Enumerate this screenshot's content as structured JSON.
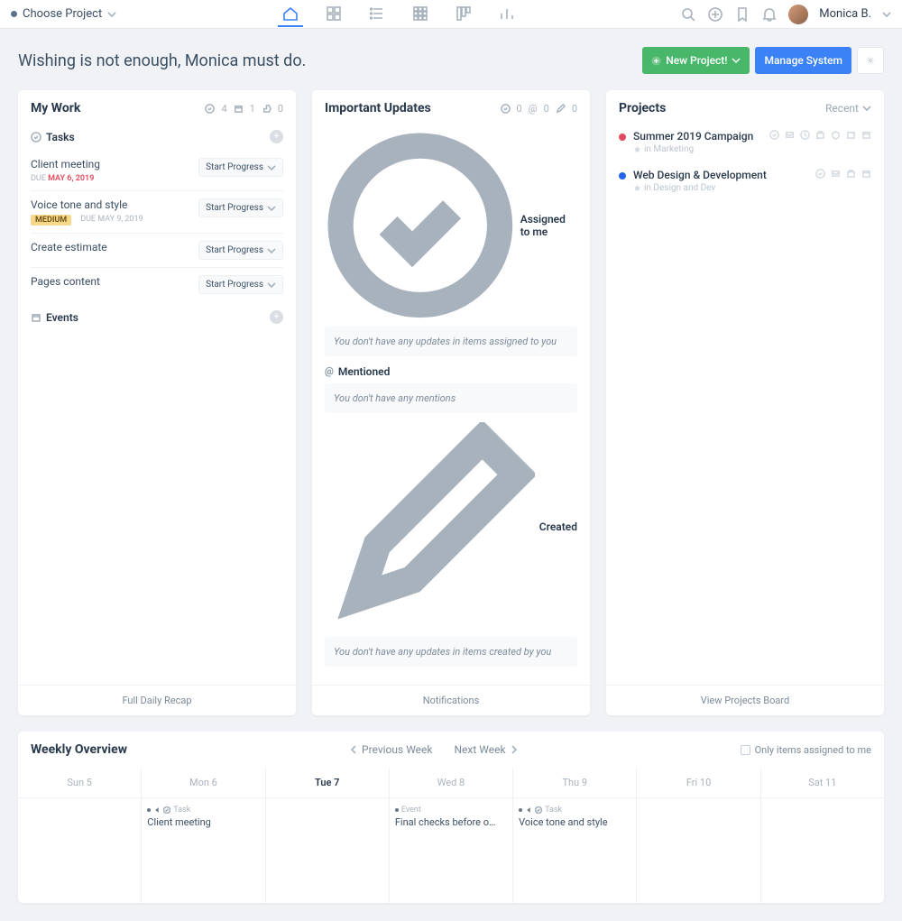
{
  "topbar": {
    "project_chooser": "Choose Project",
    "username": "Monica B."
  },
  "header": {
    "greeting": "Wishing is not enough, Monica must do.",
    "new_project": "New Project!",
    "manage_system": "Manage System"
  },
  "mywork": {
    "title": "My Work",
    "stats": {
      "done": "4",
      "cal": "1",
      "thumb": "0"
    },
    "tasks_label": "Tasks",
    "events_label": "Events",
    "start_progress": "Start Progress",
    "tasks": [
      {
        "name": "Client meeting",
        "due_label": "DUE",
        "due": "MAY 6, 2019",
        "overdue": true
      },
      {
        "name": "Voice tone and style",
        "priority": "MEDIUM",
        "due_label": "DUE",
        "due": "MAY 9, 2019"
      },
      {
        "name": "Create estimate"
      },
      {
        "name": "Pages content"
      }
    ],
    "footer": "Full Daily Recap"
  },
  "updates": {
    "title": "Important Updates",
    "stats": {
      "check": "0",
      "at": "0",
      "pencil": "0"
    },
    "sections": [
      {
        "label": "Assigned to me",
        "empty": "You don't have any updates in items assigned to you"
      },
      {
        "label": "Mentioned",
        "empty": "You don't have any mentions"
      },
      {
        "label": "Created",
        "empty": "You don't have any updates in items created by you"
      }
    ],
    "footer": "Notifications"
  },
  "projects": {
    "title": "Projects",
    "sort": "Recent",
    "in_label": "in",
    "items": [
      {
        "name": "Summer 2019 Campaign",
        "category": "Marketing",
        "color": "#e24a5f",
        "full_icons": true
      },
      {
        "name": "Web Design & Development",
        "category": "Design and Dev",
        "color": "#2563eb",
        "full_icons": false
      }
    ],
    "footer": "View Projects Board"
  },
  "overview": {
    "title": "Weekly Overview",
    "prev": "Previous Week",
    "next": "Next Week",
    "filter": "Only items assigned to me",
    "days": [
      {
        "label": "Sun 5"
      },
      {
        "label": "Mon 6",
        "items": [
          {
            "type": "Task",
            "name": "Client meeting",
            "has_check": true
          }
        ]
      },
      {
        "label": "Tue 7",
        "today": true
      },
      {
        "label": "Wed 8",
        "items": [
          {
            "type": "Event",
            "name": "Final checks before o…"
          }
        ]
      },
      {
        "label": "Thu 9",
        "items": [
          {
            "type": "Task",
            "name": "Voice tone and style",
            "has_check": true
          }
        ]
      },
      {
        "label": "Fri 10"
      },
      {
        "label": "Sat 11"
      }
    ]
  }
}
